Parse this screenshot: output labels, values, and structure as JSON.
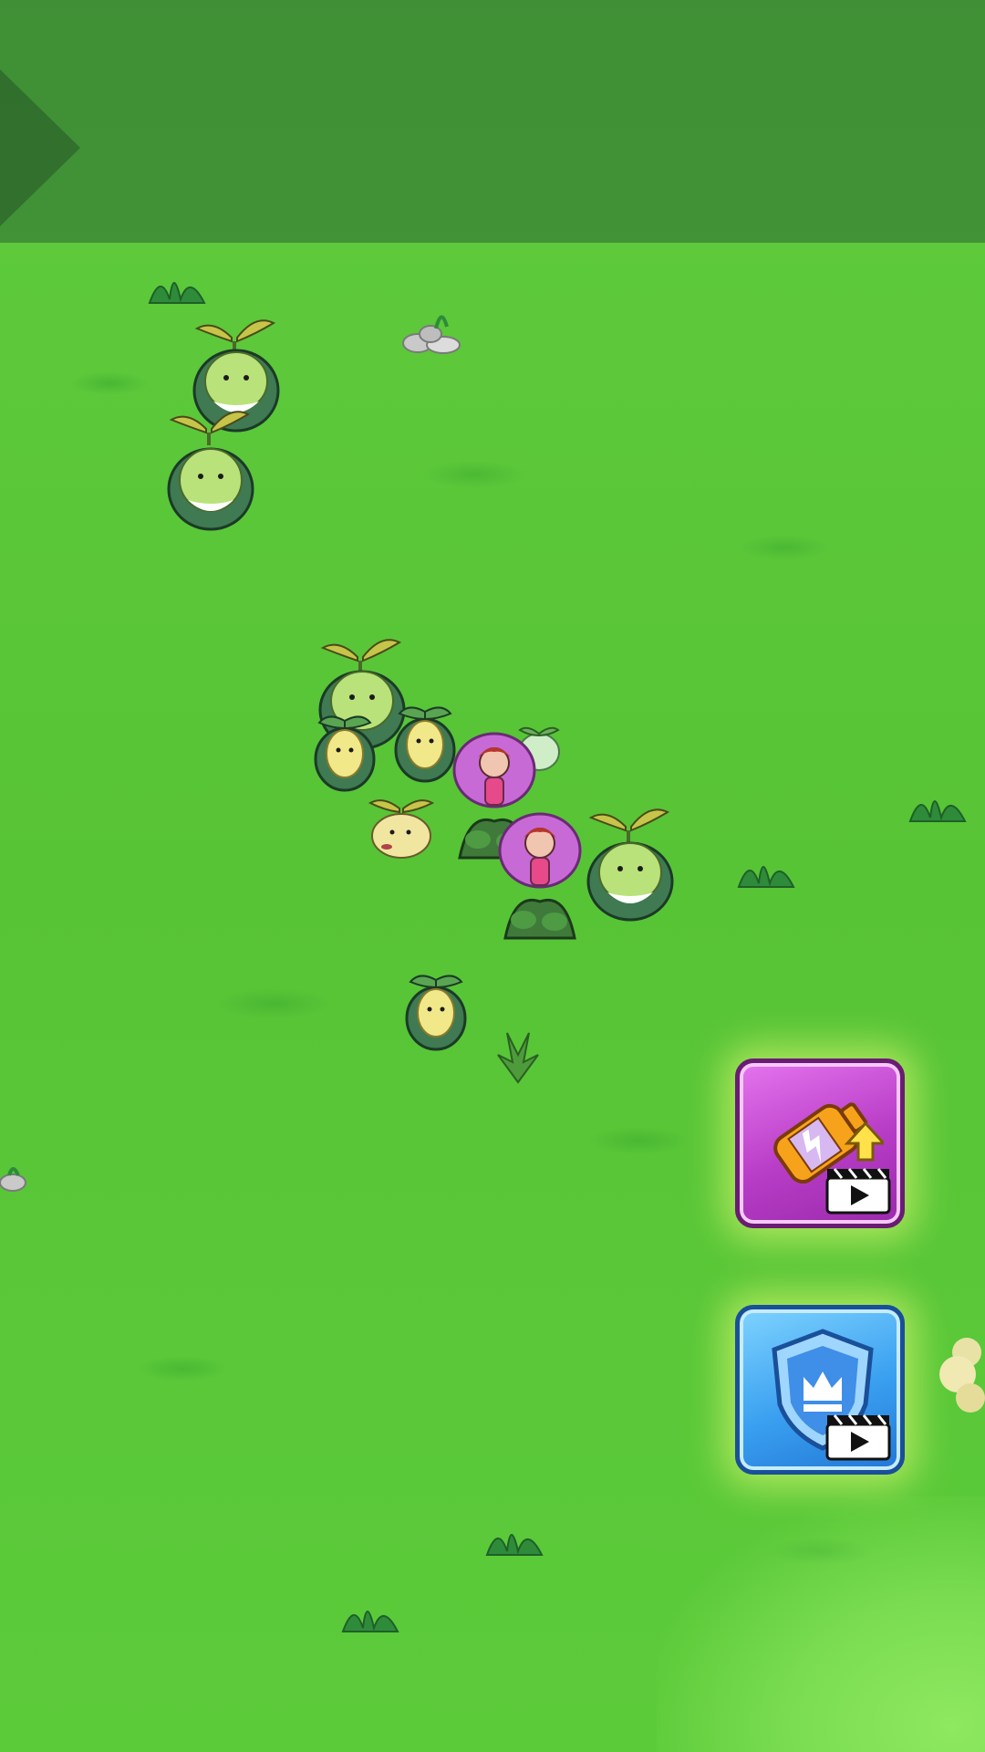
{
  "scene": {
    "name": "grass-battlefield",
    "colors": {
      "grass": "#5cc93b",
      "grass_dark_band": "#3f8d37",
      "sprout_body": "#b9e27a",
      "sprout_cloak": "#3f7a52",
      "fairy_petal": "#c86ad6",
      "boost_purple": "#b73cc6",
      "boost_blue": "#3aa0f0"
    }
  },
  "top_panel": {
    "icon": "play-arrow-icon"
  },
  "boosts": [
    {
      "id": "speed",
      "icon": "battery-upgrade-icon",
      "badge_icon": "video-clapper-icon"
    },
    {
      "id": "shield",
      "icon": "crown-shield-icon",
      "badge_icon": "video-clapper-icon"
    }
  ]
}
